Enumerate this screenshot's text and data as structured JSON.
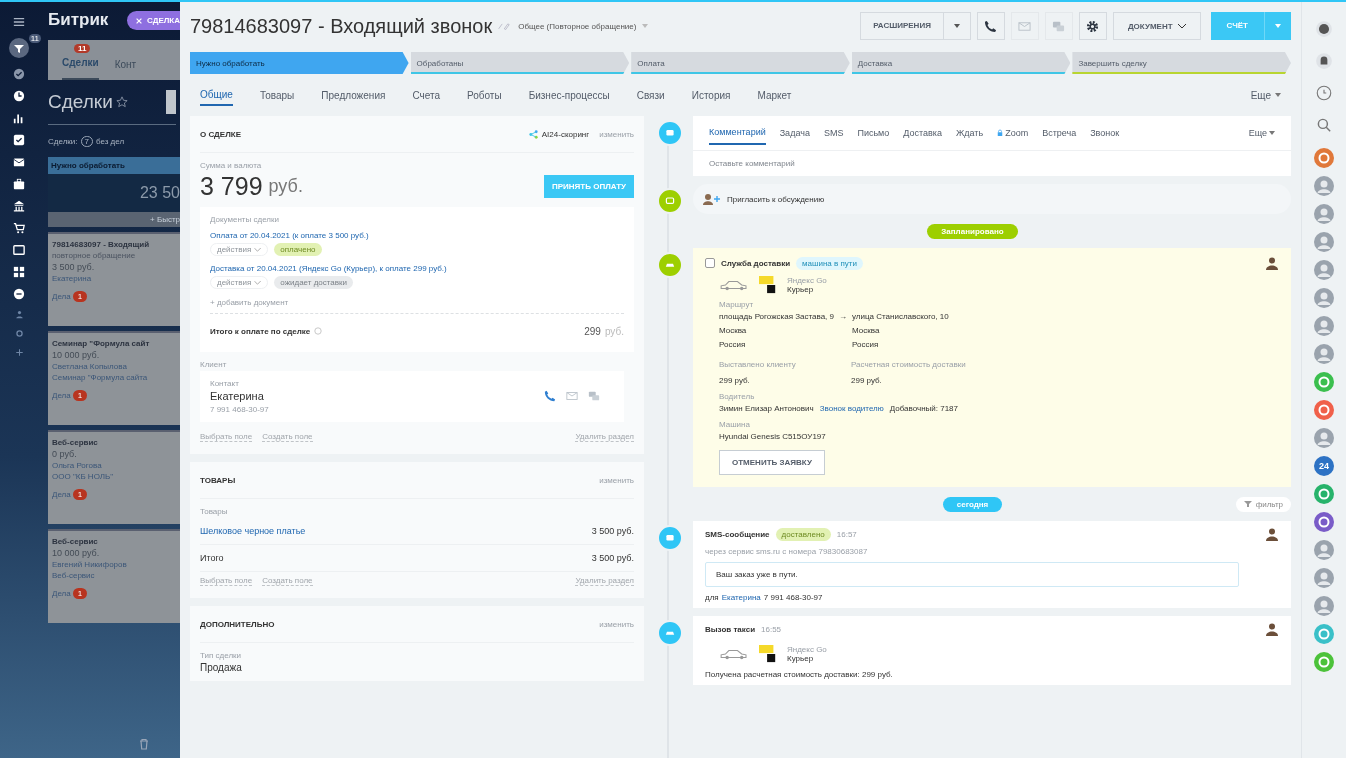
{
  "nav": {
    "badge": "11"
  },
  "background_page": {
    "logo": "Битрик",
    "close_button": "СДЕЛКА",
    "tabs": [
      {
        "label": "Сделки",
        "badge": "11",
        "selected": true
      },
      {
        "label": "Конт",
        "selected": false
      }
    ],
    "title": "Сделки",
    "counter_label": "Сделки:",
    "counter": "7",
    "counter_suffix": "без дел",
    "stage": "Нужно обработать",
    "stage_sum": "23 50",
    "quick_add": "+ Быстр",
    "cards": [
      {
        "title": "79814683097 - Входящий",
        "subtitle": "повторное обращение",
        "amount": "3 500 руб.",
        "lines": [
          "Екатерина"
        ],
        "tasks_label": "Дела",
        "tasks_count": "1"
      },
      {
        "title": "Семинар \"Формула сайт",
        "amount": "10 000 руб.",
        "lines": [
          "Светлана Копылова",
          "Семинар \"Формула сайта"
        ],
        "tasks_label": "Дела",
        "tasks_count": "1"
      },
      {
        "title": "Веб-сервис",
        "amount": "0 руб.",
        "lines": [
          "Ольга Рогова",
          "ООО \"КБ НОЛЬ\""
        ],
        "tasks_label": "Дела",
        "tasks_count": "1"
      },
      {
        "title": "Веб-сервис",
        "amount": "10 000 руб.",
        "lines": [
          "Евгений Никифоров",
          "Веб-сервис"
        ],
        "tasks_label": "Дела",
        "tasks_count": "1"
      }
    ]
  },
  "header": {
    "title": "79814683097 - Входящий звонок",
    "category": "Общее (Повторное обращение)",
    "extensions_button": "РАСШИРЕНИЯ",
    "document_button": "ДОКУМЕНТ",
    "invoice_button": "СЧЁТ"
  },
  "stages": [
    {
      "label": "Нужно обработать",
      "selected": true,
      "color": "#3fa6f0"
    },
    {
      "label": "Обработаны",
      "selected": false,
      "color": "#3fc6e6"
    },
    {
      "label": "Оплата",
      "selected": false,
      "color": "#3fc6e6"
    },
    {
      "label": "Доставка",
      "selected": false,
      "color": "#3fc6e6"
    },
    {
      "label": "Завершить сделку",
      "selected": false,
      "color": "#b8d531"
    }
  ],
  "tabs": [
    {
      "label": "Общие",
      "selected": true
    },
    {
      "label": "Товары",
      "selected": false
    },
    {
      "label": "Предложения",
      "selected": false
    },
    {
      "label": "Счета",
      "selected": false
    },
    {
      "label": "Роботы",
      "selected": false
    },
    {
      "label": "Бизнес-процессы",
      "selected": false
    },
    {
      "label": "Связи",
      "selected": false
    },
    {
      "label": "История",
      "selected": false
    },
    {
      "label": "Маркет",
      "selected": false
    }
  ],
  "tabs_more": "Еще",
  "about": {
    "title": "О СДЕЛКЕ",
    "scoring": "AI24-скоринг",
    "edit": "изменить",
    "amount_label": "Сумма и валюта",
    "amount": "3 799",
    "currency": "руб.",
    "pay_button": "ПРИНЯТЬ ОПЛАТУ",
    "documents": {
      "label": "Документы сделки",
      "items": [
        {
          "link": "Оплата от 20.04.2021 (к оплате 3 500 руб.)",
          "actions": "действия",
          "status": "оплачено",
          "kind": "paid"
        },
        {
          "link": "Доставка от 20.04.2021 (Яндекс Go (Курьер), к оплате 299 руб.)",
          "actions": "действия",
          "status": "ожидает доставки",
          "kind": "pending"
        }
      ],
      "add": "+ добавить документ",
      "total_label": "Итого к оплате по сделке",
      "total": "299",
      "total_currency": "руб."
    },
    "client_label": "Клиент",
    "contact": {
      "label": "Контакт",
      "name": "Екатерина",
      "phone": "7 991 468-30-97"
    },
    "footer_links": [
      "Выбрать поле",
      "Создать поле"
    ],
    "delete": "Удалить раздел"
  },
  "products": {
    "title": "ТОВАРЫ",
    "edit": "изменить",
    "label": "Товары",
    "rows": [
      {
        "name": "Шелковое черное платье",
        "price": "3 500 руб.",
        "kind": "item"
      },
      {
        "name": "Итого",
        "price": "3 500 руб.",
        "kind": "total"
      }
    ],
    "footer_links": [
      "Выбрать поле",
      "Создать поле"
    ],
    "delete": "Удалить раздел"
  },
  "extra": {
    "title": "ДОПОЛНИТЕЛЬНО",
    "edit": "изменить",
    "field_label": "Тип сделки",
    "value": "Продажа"
  },
  "composer": {
    "tabs": [
      {
        "label": "Комментарий",
        "selected": true,
        "locked": false
      },
      {
        "label": "Задача",
        "selected": false,
        "locked": false
      },
      {
        "label": "SMS",
        "selected": false,
        "locked": false
      },
      {
        "label": "Письмо",
        "selected": false,
        "locked": false
      },
      {
        "label": "Доставка",
        "selected": false,
        "locked": false
      },
      {
        "label": "Ждать",
        "selected": false,
        "locked": false
      },
      {
        "label": "Zoom",
        "selected": false,
        "locked": true
      },
      {
        "label": "Встреча",
        "selected": false,
        "locked": false
      },
      {
        "label": "Звонок",
        "selected": false,
        "locked": false
      }
    ],
    "more": "Еще",
    "placeholder": "Оставьте комментарий"
  },
  "invite": "Пригласить к обсуждению",
  "planned_label": "Запланировано",
  "delivery": {
    "checked": false,
    "title": "Служба доставки",
    "status": "машина в пути",
    "provider": "Яндекс Go",
    "service": "Курьер",
    "route_label": "Маршрут",
    "from": "площадь Рогожская Застава, 9",
    "route_arrow": "→",
    "to": "улица Станиславского, 10",
    "from_city": "Москва",
    "to_city": "Москва",
    "from_country": "Россия",
    "to_country": "Россия",
    "billed_label": "Выставлено клиенту",
    "billed": "299 руб.",
    "estimate_label": "Расчетная стоимость доставки",
    "estimate": "299 руб.",
    "driver_label": "Водитель",
    "driver": "Зимин Елизар Антонович",
    "call_driver": "Звонок водителю",
    "extension": "Добавочный: 7187",
    "car_label": "Машина",
    "car": "Hyundai Genesis С515ОУ197",
    "cancel_button": "ОТМЕНИТЬ ЗАЯВКУ"
  },
  "today_label": "сегодня",
  "filter": "фильтр",
  "sms": {
    "title": "SMS-сообщение",
    "status": "доставлено",
    "time": "16:57",
    "via": "через сервис sms.ru с номера 79830683087",
    "message": "Ваш заказ уже в пути.",
    "to_prefix": "для",
    "to_name": "Екатерина",
    "to_phone": "7 991 468-30-97"
  },
  "taxi": {
    "title": "Вызов такси",
    "time": "16:55",
    "provider": "Яндекс Go",
    "service": "Курьер",
    "text": "Получена расчетная стоимость доставки: 299 руб."
  },
  "right_bar": [
    {
      "kind": "app",
      "color": "#e0783a"
    },
    {
      "kind": "avatar"
    },
    {
      "kind": "avatar"
    },
    {
      "kind": "avatar"
    },
    {
      "kind": "avatar"
    },
    {
      "kind": "avatar"
    },
    {
      "kind": "avatar"
    },
    {
      "kind": "avatar"
    },
    {
      "kind": "app",
      "color": "#3bbf4e"
    },
    {
      "kind": "app",
      "color": "#f0604a"
    },
    {
      "kind": "avatar"
    },
    {
      "kind": "number",
      "color": "#2d72c4",
      "text": "24"
    },
    {
      "kind": "app",
      "color": "#27b36b"
    },
    {
      "kind": "app",
      "color": "#7a5cc8"
    },
    {
      "kind": "avatar"
    },
    {
      "kind": "avatar"
    },
    {
      "kind": "avatar"
    },
    {
      "kind": "app",
      "color": "#3ac0c8"
    },
    {
      "kind": "app",
      "color": "#4cc23a"
    }
  ]
}
